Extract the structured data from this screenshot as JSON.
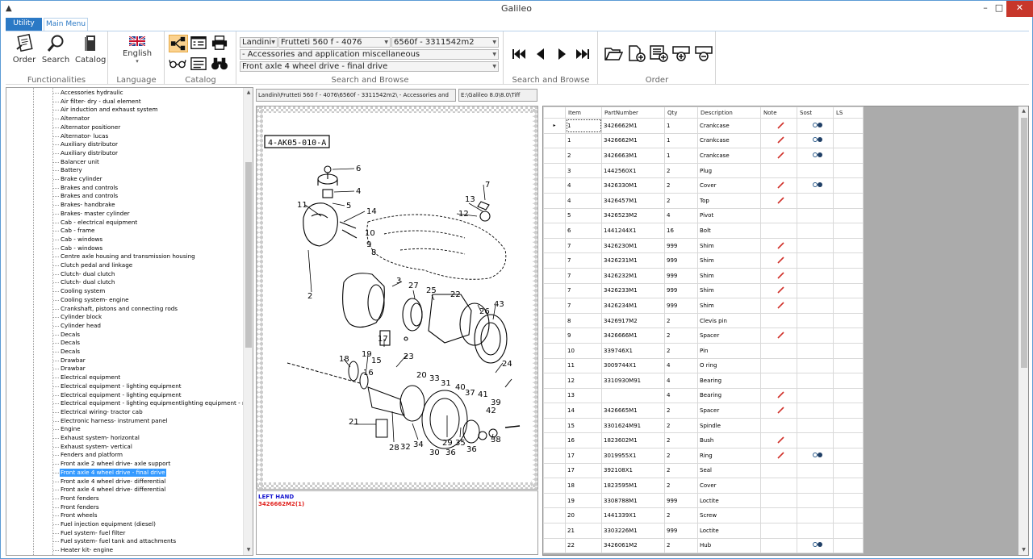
{
  "window": {
    "title": "Galileo"
  },
  "ribbon": {
    "tabs": [
      "Utility",
      "Main Menu"
    ],
    "functionalities": {
      "caption": "Functionalities",
      "order": "Order",
      "search": "Search",
      "catalog": "Catalog"
    },
    "language": {
      "caption": "Language",
      "value": "English"
    },
    "catalog_group": {
      "caption": "Catalog"
    },
    "search_browse": {
      "caption": "Search and Browse",
      "brand": "Landini",
      "model": "Frutteti 560 f - 4076",
      "serial": "6560f - 3311542m2",
      "group": "- Accessories and application miscellaneous",
      "table": "Front axle 4 wheel drive - final drive"
    },
    "navigation": {
      "caption": "Search and Browse"
    },
    "order": {
      "caption": "Order"
    }
  },
  "tree": {
    "items": [
      "Accessories hydraulic",
      "Air filter- dry - dual element",
      "Air induction and exhaust system",
      "Alternator",
      "Alternator positioner",
      "Alternator- lucas",
      "Auxiliary distributor",
      "Auxiliary distributor",
      "Balancer unit",
      "Battery",
      "Brake cylinder",
      "Brakes and controls",
      "Brakes and controls",
      "Brakes- handbrake",
      "Brakes- master cylinder",
      "Cab - electrical equipment",
      "Cab - frame",
      "Cab - windows",
      "Cab - windows",
      "Centre axle housing and transmission housing",
      "Clutch pedal and linkage",
      "Clutch- dual clutch",
      "Clutch- dual clutch",
      "Cooling system",
      "Cooling system- engine",
      "Crankshaft, pistons and connecting rods",
      "Cylinder block",
      "Cylinder head",
      "Decals",
      "Decals",
      "Decals",
      "Drawbar",
      "Drawbar",
      "Electrical equipment",
      "Electrical equipment - lighting equipment",
      "Electrical equipment - lighting equipment",
      "Electrical equipment - lighting equipmentlighting equipment - rear",
      "Electrical wiring- tractor cab",
      "Electronic harness- instrument panel",
      "Engine",
      "Exhaust system- horizontal",
      "Exhaust system- vertical",
      "Fenders and platform",
      "Front axle 2 wheel drive- axle support",
      "Front axle 4 wheel drive - final drive",
      "Front axle 4 wheel drive- differential",
      "Front axle 4 wheel drive- differential",
      "Front fenders",
      "Front fenders",
      "Front wheels",
      "Fuel injection equipment (diesel)",
      "Fuel system- fuel filter",
      "Fuel system- fuel tank and attachments",
      "Heater kit- engine"
    ],
    "selected_index": 44
  },
  "path": {
    "breadcrumb": "Landini\\Frutteti 560 f - 4076\\6560f - 3311542m2\\ - Accessories and",
    "file": "E:\\Galileo 8.0\\8.0\\Tiff"
  },
  "drawing": {
    "code": "4-AK05-010-A",
    "callouts": [
      "6",
      "7",
      "4",
      "5",
      "11",
      "13",
      "14",
      "12",
      "10",
      "9",
      "8",
      "3",
      "27",
      "25",
      "22",
      "26",
      "43",
      "2",
      "17",
      "19",
      "15",
      "18",
      "16",
      "23",
      "24",
      "20",
      "33",
      "31",
      "40",
      "37",
      "41",
      "39",
      "42",
      "21",
      "28",
      "32",
      "34",
      "29",
      "35",
      "38",
      "36",
      "30",
      "36"
    ]
  },
  "notes": {
    "line1": "LEFT HAND",
    "line2": "3426662M2(1)"
  },
  "parts_table": {
    "columns": [
      "Item",
      "PartNumber",
      "Qty",
      "Description",
      "Note",
      "Sost",
      "LS"
    ],
    "rows": [
      {
        "item": "1",
        "part": "3426662M1",
        "qty": "1",
        "desc": "Crankcase",
        "note": true,
        "sost": true
      },
      {
        "item": "1",
        "part": "3426662M1",
        "qty": "1",
        "desc": "Crankcase",
        "note": true,
        "sost": true
      },
      {
        "item": "2",
        "part": "3426663M1",
        "qty": "1",
        "desc": "Crankcase",
        "note": true,
        "sost": true
      },
      {
        "item": "3",
        "part": "1442560X1",
        "qty": "2",
        "desc": "Plug",
        "note": false,
        "sost": false
      },
      {
        "item": "4",
        "part": "3426330M1",
        "qty": "2",
        "desc": "Cover",
        "note": true,
        "sost": true
      },
      {
        "item": "4",
        "part": "3426457M1",
        "qty": "2",
        "desc": "Top",
        "note": true,
        "sost": false
      },
      {
        "item": "5",
        "part": "3426523M2",
        "qty": "4",
        "desc": "Pivot",
        "note": false,
        "sost": false
      },
      {
        "item": "6",
        "part": "1441244X1",
        "qty": "16",
        "desc": "Bolt",
        "note": false,
        "sost": false
      },
      {
        "item": "7",
        "part": "3426230M1",
        "qty": "999",
        "desc": "Shim",
        "note": true,
        "sost": false
      },
      {
        "item": "7",
        "part": "3426231M1",
        "qty": "999",
        "desc": "Shim",
        "note": true,
        "sost": false
      },
      {
        "item": "7",
        "part": "3426232M1",
        "qty": "999",
        "desc": "Shim",
        "note": true,
        "sost": false
      },
      {
        "item": "7",
        "part": "3426233M1",
        "qty": "999",
        "desc": "Shim",
        "note": true,
        "sost": false
      },
      {
        "item": "7",
        "part": "3426234M1",
        "qty": "999",
        "desc": "Shim",
        "note": true,
        "sost": false
      },
      {
        "item": "8",
        "part": "3426917M2",
        "qty": "2",
        "desc": "Clevis pin",
        "note": false,
        "sost": false
      },
      {
        "item": "9",
        "part": "3426666M1",
        "qty": "2",
        "desc": "Spacer",
        "note": true,
        "sost": false
      },
      {
        "item": "10",
        "part": "339746X1",
        "qty": "2",
        "desc": "Pin",
        "note": false,
        "sost": false
      },
      {
        "item": "11",
        "part": "3009744X1",
        "qty": "4",
        "desc": "O ring",
        "note": false,
        "sost": false
      },
      {
        "item": "12",
        "part": "3310930M91",
        "qty": "4",
        "desc": "Bearing",
        "note": false,
        "sost": false
      },
      {
        "item": "13",
        "part": "",
        "qty": "4",
        "desc": "Bearing",
        "note": true,
        "sost": false
      },
      {
        "item": "14",
        "part": "3426665M1",
        "qty": "2",
        "desc": "Spacer",
        "note": true,
        "sost": false
      },
      {
        "item": "15",
        "part": "3301624M91",
        "qty": "2",
        "desc": "Spindle",
        "note": false,
        "sost": false
      },
      {
        "item": "16",
        "part": "1823602M1",
        "qty": "2",
        "desc": "Bush",
        "note": true,
        "sost": false
      },
      {
        "item": "17",
        "part": "3019955X1",
        "qty": "2",
        "desc": "Ring",
        "note": true,
        "sost": true
      },
      {
        "item": "17",
        "part": "392108X1",
        "qty": "2",
        "desc": "Seal",
        "note": false,
        "sost": false
      },
      {
        "item": "18",
        "part": "1823595M1",
        "qty": "2",
        "desc": "Cover",
        "note": false,
        "sost": false
      },
      {
        "item": "19",
        "part": "3308788M1",
        "qty": "999",
        "desc": "Loctite",
        "note": false,
        "sost": false
      },
      {
        "item": "20",
        "part": "1441339X1",
        "qty": "2",
        "desc": "Screw",
        "note": false,
        "sost": false
      },
      {
        "item": "21",
        "part": "3303226M1",
        "qty": "999",
        "desc": "Loctite",
        "note": false,
        "sost": false
      },
      {
        "item": "22",
        "part": "3426061M2",
        "qty": "2",
        "desc": "Hub",
        "note": false,
        "sost": true
      }
    ]
  },
  "colors": {
    "accent": "#2b79c5",
    "selection": "#3399ff",
    "note_pen": "#d0302a",
    "close": "#c7372b"
  }
}
